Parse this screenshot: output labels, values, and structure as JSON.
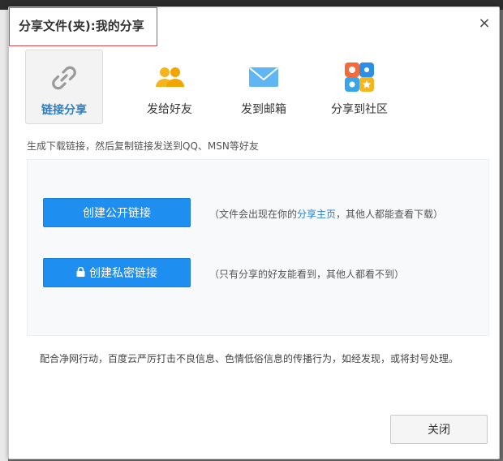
{
  "dialog": {
    "title": "分享文件(夹):我的分享",
    "close_glyph": "×"
  },
  "tabs": [
    {
      "label": "链接分享",
      "icon": "link-icon",
      "active": true
    },
    {
      "label": "发给好友",
      "icon": "friends-icon",
      "active": false
    },
    {
      "label": "发到邮箱",
      "icon": "mail-icon",
      "active": false
    },
    {
      "label": "分享到社区",
      "icon": "community-icon",
      "active": false
    }
  ],
  "description": "生成下载链接，然后复制链接发送到QQ、MSN等好友",
  "public_link": {
    "button_label": "创建公开链接",
    "note_prefix": "（文件会出现在你的",
    "note_link": "分享主页",
    "note_suffix": "，其他人都能查看下载）"
  },
  "private_link": {
    "button_label": "创建私密链接",
    "note": "（只有分享的好友能看到，其他人都看不到）"
  },
  "policy": "配合净网行动，百度云严厉打击不良信息、色情低俗信息的传播行为，如经发现，或将封号处理。",
  "footer": {
    "close_label": "关闭"
  },
  "colors": {
    "primary_button": "#1e8ef0",
    "link_text": "#2a7fc8",
    "title_highlight": "#d84a4a"
  }
}
